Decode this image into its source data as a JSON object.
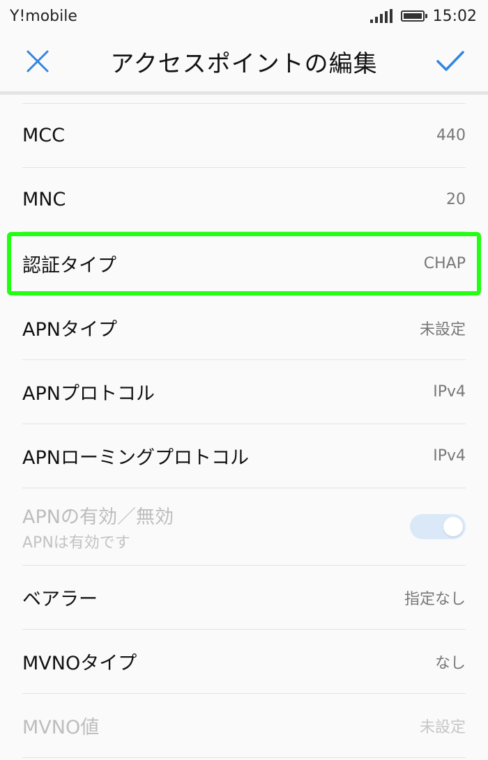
{
  "status_bar": {
    "carrier": "Y!mobile",
    "time": "15:02",
    "icons": [
      "signal-icon",
      "battery-icon"
    ]
  },
  "app_bar": {
    "title": "アクセスポイントの編集",
    "close_icon": "close-icon",
    "save_icon": "check-icon",
    "accent": "#2f86e0"
  },
  "settings": {
    "mcc": {
      "label": "MCC",
      "value": "440"
    },
    "mnc": {
      "label": "MNC",
      "value": "20"
    },
    "auth_type": {
      "label": "認証タイプ",
      "value": "CHAP"
    },
    "apn_type": {
      "label": "APNタイプ",
      "value": "未設定"
    },
    "apn_protocol": {
      "label": "APNプロトコル",
      "value": "IPv4"
    },
    "apn_roaming_protocol": {
      "label": "APNローミングプロトコル",
      "value": "IPv4"
    },
    "apn_enable": {
      "label": "APNの有効／無効",
      "sublabel": "APNは有効です",
      "toggle_on": true
    },
    "bearer": {
      "label": "ベアラー",
      "value": "指定なし"
    },
    "mvno_type": {
      "label": "MVNOタイプ",
      "value": "なし"
    },
    "mvno_value": {
      "label": "MVNO値",
      "value": "未設定"
    }
  },
  "highlight_color": "#22ff12"
}
